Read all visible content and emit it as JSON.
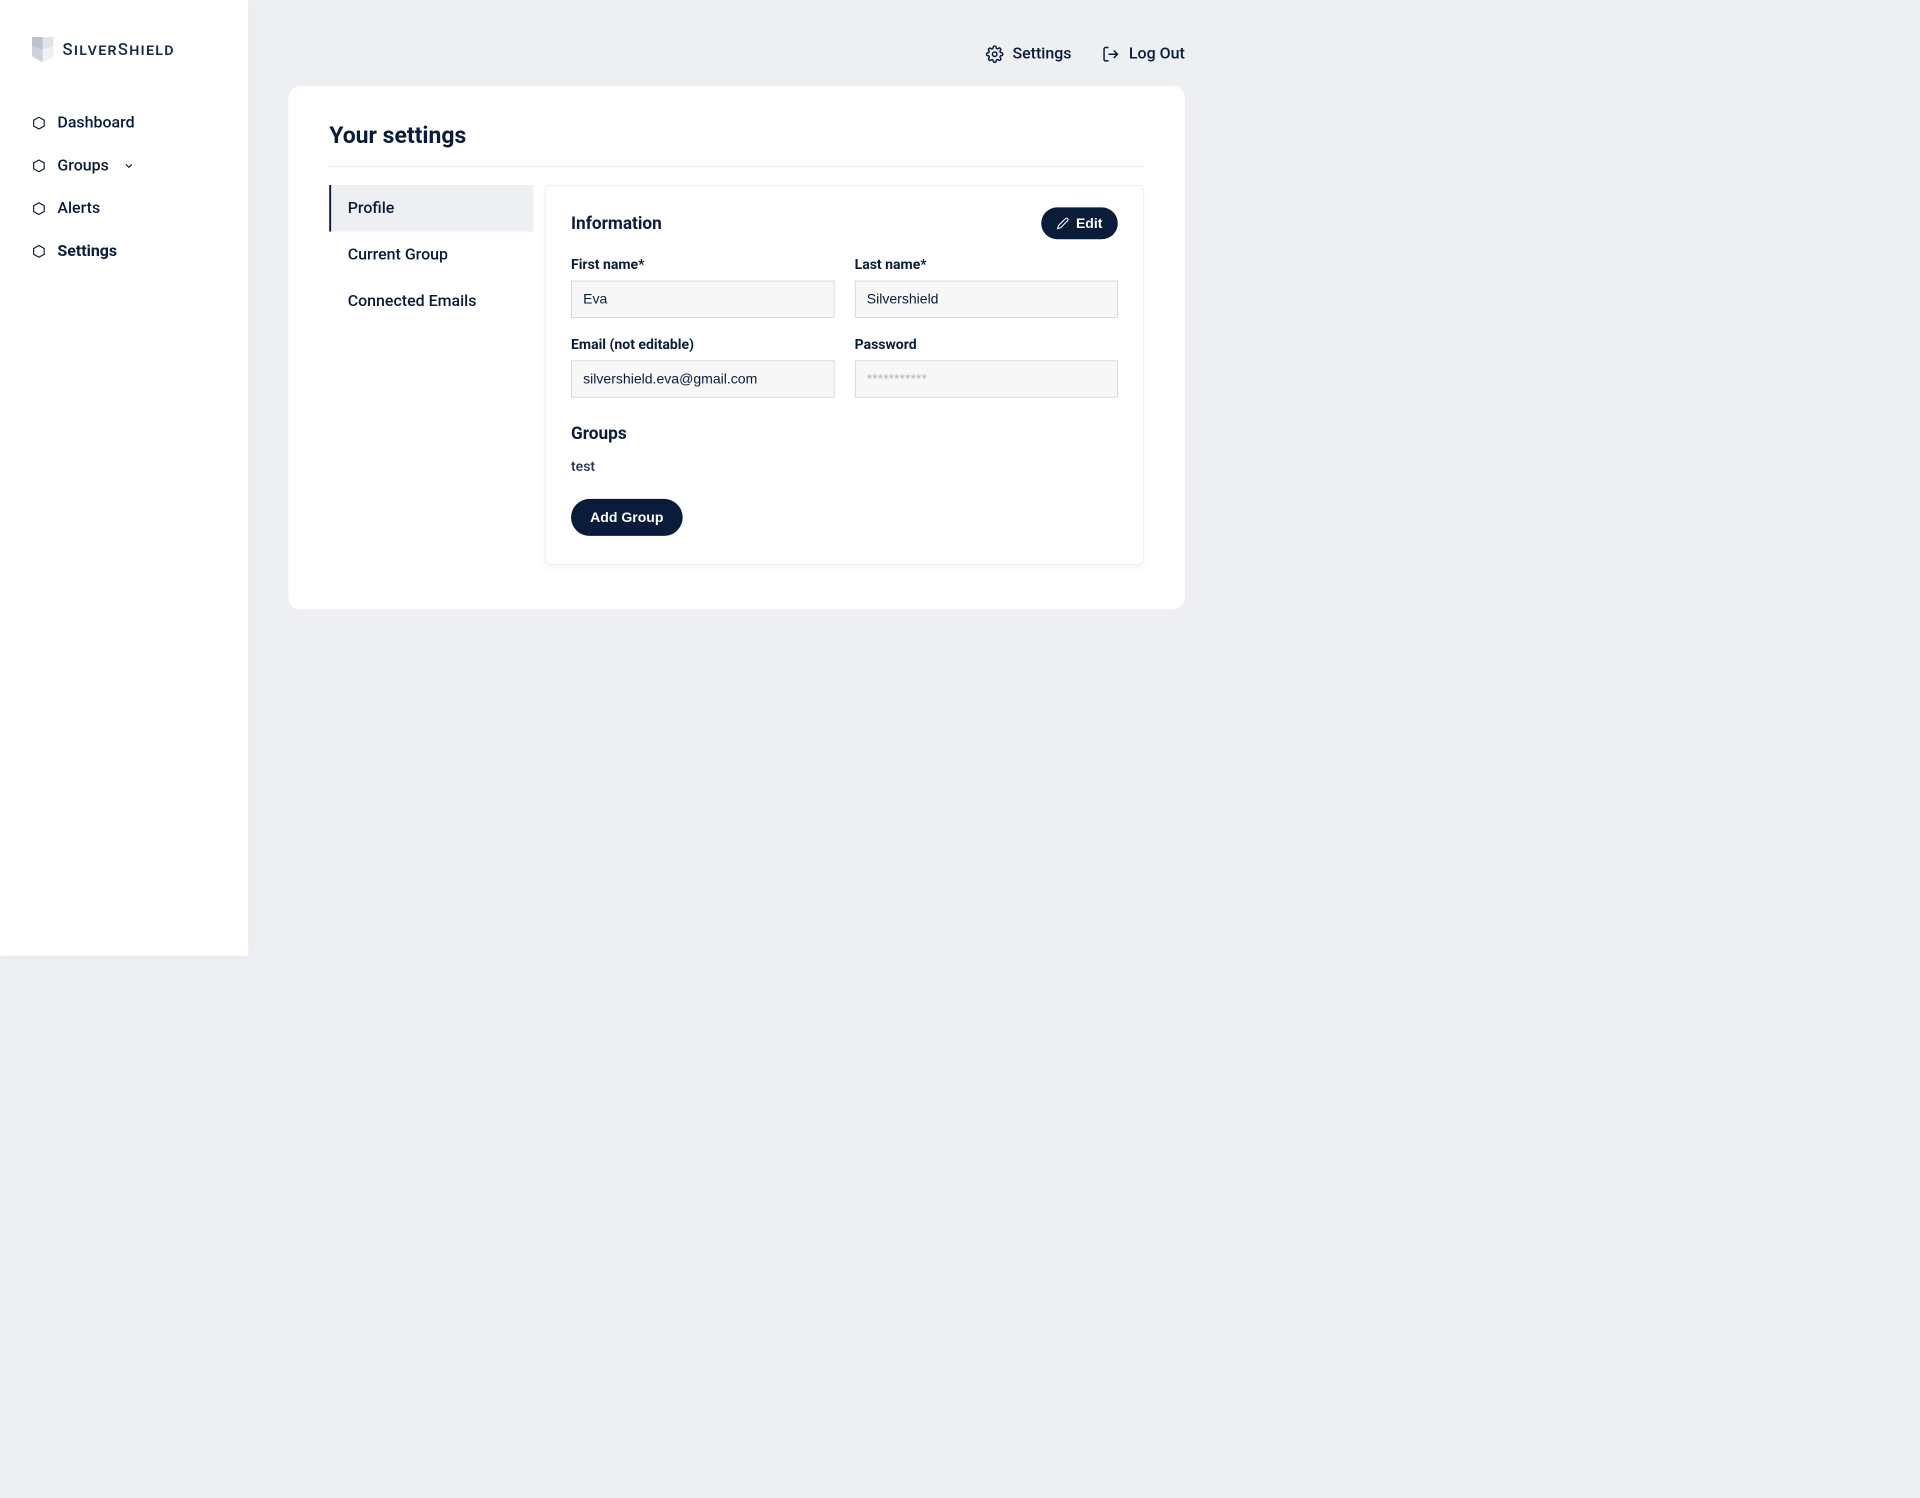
{
  "brand": {
    "name": "SilverShield"
  },
  "sidebar": {
    "items": [
      {
        "label": "Dashboard",
        "active": false,
        "hasChildren": false
      },
      {
        "label": "Groups",
        "active": false,
        "hasChildren": true
      },
      {
        "label": "Alerts",
        "active": false,
        "hasChildren": false
      },
      {
        "label": "Settings",
        "active": true,
        "hasChildren": false
      }
    ]
  },
  "topbar": {
    "settings": "Settings",
    "logout": "Log Out"
  },
  "page": {
    "title": "Your settings"
  },
  "tabs": [
    {
      "label": "Profile",
      "active": true
    },
    {
      "label": "Current Group",
      "active": false
    },
    {
      "label": "Connected Emails",
      "active": false
    }
  ],
  "profile": {
    "sectionTitle": "Information",
    "editLabel": "Edit",
    "fields": {
      "firstName": {
        "label": "First name*",
        "value": "Eva"
      },
      "lastName": {
        "label": "Last name*",
        "value": "Silvershield"
      },
      "email": {
        "label": "Email (not editable)",
        "value": "silvershield.eva@gmail.com"
      },
      "password": {
        "label": "Password",
        "placeholder": "***********"
      }
    },
    "groupsTitle": "Groups",
    "groups": [
      "test"
    ],
    "addGroupLabel": "Add Group"
  }
}
